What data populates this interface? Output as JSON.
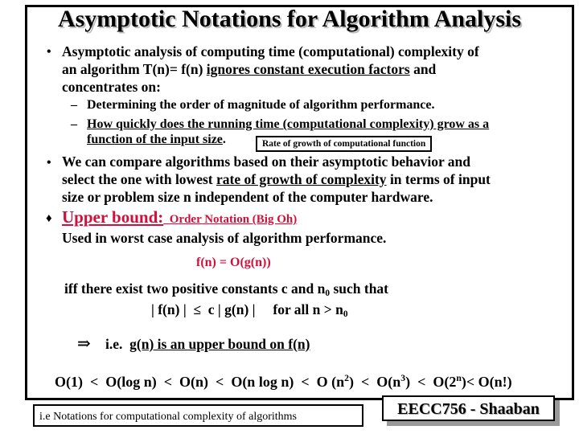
{
  "slide": {
    "title": "Asymptotic Notations for Algorithm Analysis",
    "bullet1": {
      "marker": "•",
      "line1": "Asymptotic analysis of computing time (computational) complexity of",
      "line2_pre": "an algorithm T(n)= f(n) ",
      "line2_underlined": "ignores constant execution factors",
      "line2_post": " and",
      "line3": "concentrates on:"
    },
    "subbullets": [
      {
        "marker": "–",
        "text": "Determining the order of magnitude of algorithm performance."
      },
      {
        "marker": "–",
        "line1": "How quickly does the running time (computational complexity) grow as a",
        "line2": "function of the input size",
        "line2_post": "."
      }
    ],
    "note_box": "Rate of growth of computational function",
    "bullet2": {
      "marker": "•",
      "line1": "We can compare algorithms based on their asymptotic behavior and",
      "line2_pre": "select the one with lowest ",
      "line2_underlined": "rate of growth of complexity",
      "line2_post": " in terms of input",
      "line3": "size or problem size n  independent of the computer hardware."
    },
    "upper_bound": {
      "marker": "♦",
      "heading": "Upper bound:",
      "subheading": "Order Notation (Big Oh)",
      "desc": "Used in worst case analysis of algorithm performance.",
      "formula": "f(n) = O(g(n))",
      "iff_pre": "iff there exist two positive constants c and n",
      "iff_sub": "0",
      "iff_post": " such that",
      "ineq_pre": "| f(n) |  ≤  c | g(n) |     for all n > n",
      "ineq_sub": "0",
      "implies_symbol": "⇒",
      "implies_pre": "i.e.",
      "implies_underlined": "g(n)  is an upper bound on  f(n)"
    },
    "growth_order": [
      {
        "base": "O(1)"
      },
      {
        "base": "O(log n)"
      },
      {
        "base": "O(n)"
      },
      {
        "base": "O(n log n)"
      },
      {
        "base": "O (n",
        "sup": "2",
        "post": ")"
      },
      {
        "base": "O(n",
        "sup": "3",
        "post": ")"
      },
      {
        "base": "O(2",
        "sup": "n",
        "post": ")"
      },
      {
        "base": "O(n!)"
      }
    ],
    "lt": "<",
    "footer_left": "i.e Notations for computational complexity of algorithms",
    "footer_right": "EECC756 - Shaaban",
    "colors": {
      "accent_red": "#d0103a",
      "text": "#000000",
      "shadow": "#999999"
    }
  }
}
